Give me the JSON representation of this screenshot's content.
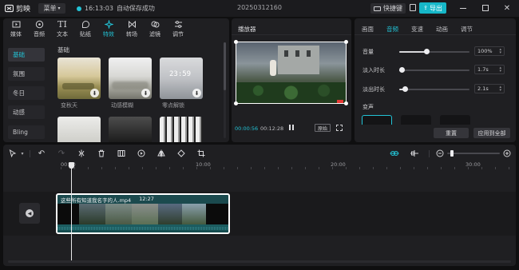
{
  "app": {
    "name": "剪映",
    "menu_label": "菜单"
  },
  "save_status": {
    "time": "16:13:03",
    "text": "自动保存成功"
  },
  "project_title": "20250312160",
  "header": {
    "shortcut_label": "快捷键",
    "export_label": "导出"
  },
  "media_tabs": [
    {
      "label": "媒体",
      "icon": "media-icon"
    },
    {
      "label": "音频",
      "icon": "audio-icon"
    },
    {
      "label": "文本",
      "icon": "text-icon"
    },
    {
      "label": "贴纸",
      "icon": "sticker-icon"
    },
    {
      "label": "特效",
      "icon": "effects-icon",
      "active": true
    },
    {
      "label": "转场",
      "icon": "transition-icon"
    },
    {
      "label": "滤镜",
      "icon": "filter-icon"
    },
    {
      "label": "调节",
      "icon": "adjust-icon"
    }
  ],
  "effect_categories": [
    "基础",
    "氛围",
    "冬日",
    "动感",
    "Bling"
  ],
  "section_label": "基础",
  "effects": [
    {
      "label": "变秋天"
    },
    {
      "label": "动感模糊"
    },
    {
      "label": "零点解锁",
      "overlay_time": "23:59"
    }
  ],
  "player": {
    "title": "播放器",
    "current_time": "00:00:56",
    "total_time": "00:12:28",
    "ratio_label": "原始"
  },
  "props": {
    "tabs": [
      "画面",
      "音频",
      "变速",
      "动画",
      "调节"
    ],
    "active_tab": "音频",
    "volume": {
      "label": "音量",
      "value": "100%"
    },
    "fade_in": {
      "label": "淡入时长",
      "value": "1.7s"
    },
    "fade_out": {
      "label": "淡出时长",
      "value": "2.1s"
    },
    "voice_change_label": "变声",
    "reset_label": "重置",
    "apply_all_label": "应用到全部"
  },
  "timeline": {
    "ruler": [
      "00:00",
      "10:00",
      "20:00",
      "30:00"
    ],
    "clip_name": "这些所有知道我名字的人.mp4",
    "clip_duration": "12:27"
  },
  "colors": {
    "accent": "#22c3d6",
    "panel": "#1f1f22",
    "bg": "#0f0f10"
  }
}
